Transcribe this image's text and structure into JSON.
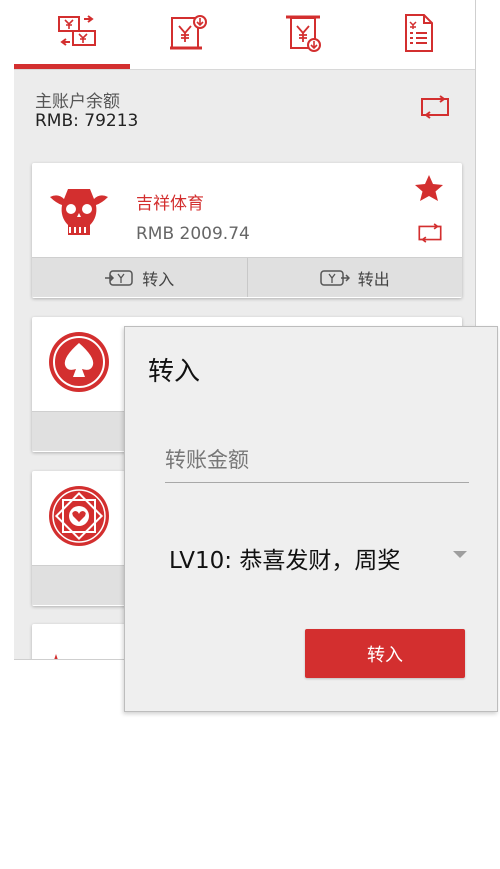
{
  "tabs": [
    {
      "icon": "currency-exchange-icon"
    },
    {
      "icon": "deposit-icon"
    },
    {
      "icon": "withdraw-icon"
    },
    {
      "icon": "records-icon"
    }
  ],
  "colors": {
    "accent": "#d32f2f",
    "background": "#ececec",
    "card": "#ffffff",
    "action_bar": "#e0e0e0"
  },
  "main_account": {
    "label": "主账户余额",
    "balance": "RMB: 79213",
    "refresh_icon": "refresh-icon"
  },
  "platforms": [
    {
      "name": "吉祥体育",
      "amount": "RMB 2009.74",
      "logo_icon": "skull-logo-icon",
      "favorite_icon": "star-icon",
      "refresh_icon": "refresh-icon",
      "transfer_in_label": "转入",
      "transfer_out_label": "转出"
    },
    {
      "logo_icon": "spade-logo-icon"
    },
    {
      "logo_icon": "heart-emblem-logo-icon"
    },
    {
      "logo_icon": "partial-logo-icon"
    }
  ],
  "dialog": {
    "title": "转入",
    "amount_placeholder": "转账金额",
    "selected_option": "LV10: 恭喜发财，周奖",
    "confirm_label": "转入"
  }
}
